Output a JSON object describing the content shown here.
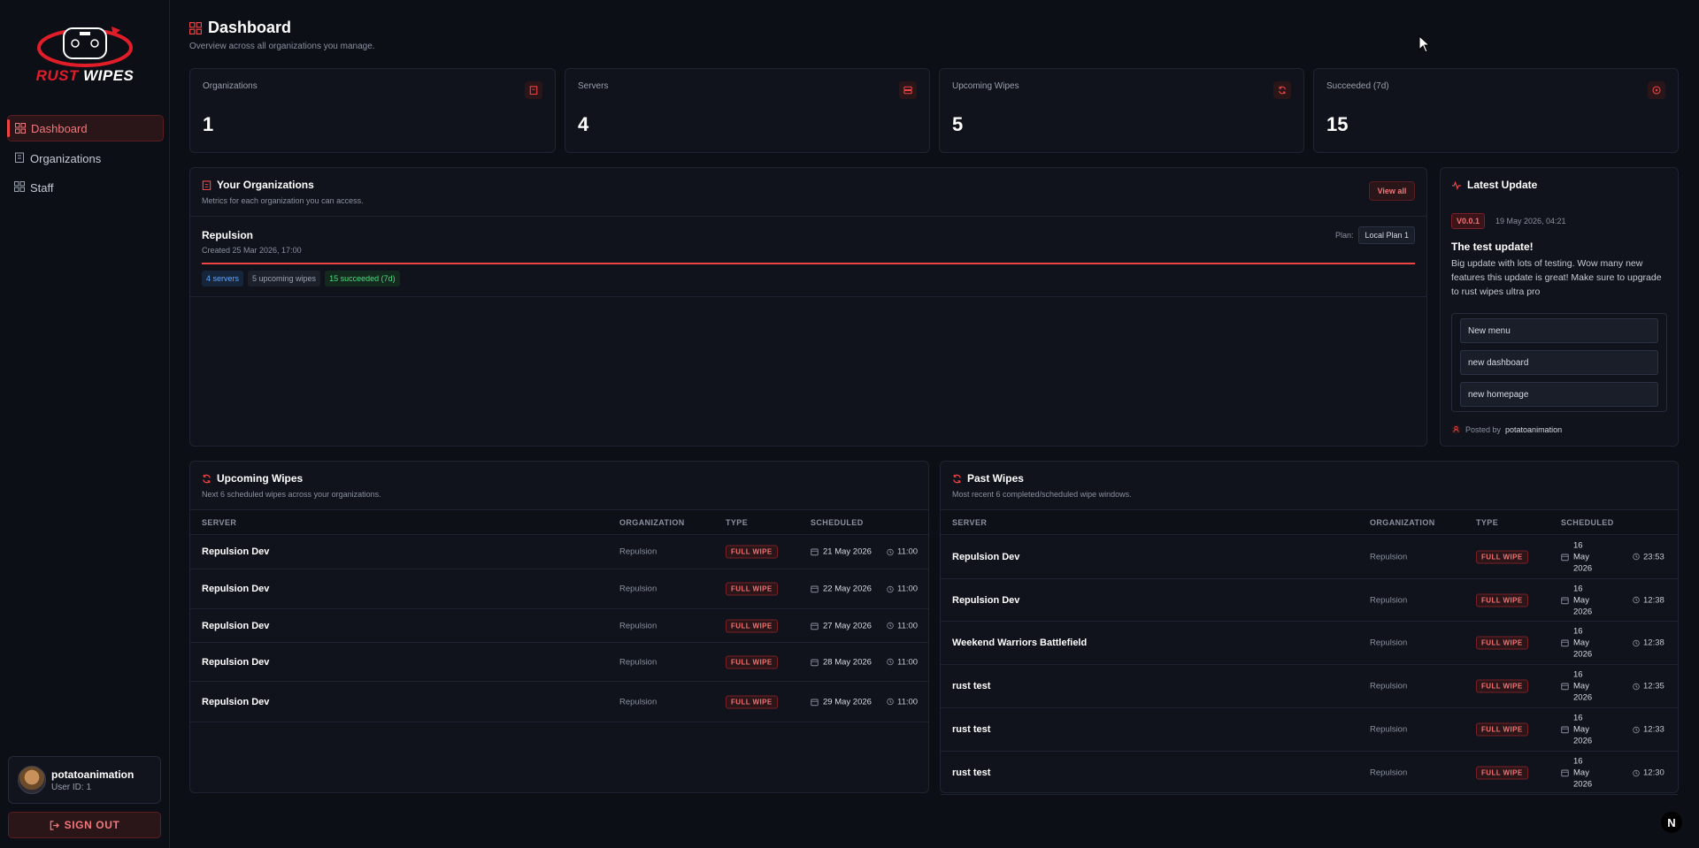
{
  "brand": {
    "name_part1": "RUST",
    "name_part2": "WIPES",
    "accent": "#ef4444"
  },
  "sidebar": {
    "items": [
      {
        "label": "Dashboard",
        "icon": "dashboard-icon",
        "active": true
      },
      {
        "label": "Organizations",
        "icon": "building-icon",
        "active": false
      },
      {
        "label": "Staff",
        "icon": "staff-icon",
        "active": false
      }
    ],
    "user": {
      "name": "potatoanimation",
      "id_text": "User ID: 1"
    },
    "signout_label": "SIGN OUT"
  },
  "header": {
    "title": "Dashboard",
    "subtitle": "Overview across all organizations you manage."
  },
  "stats": [
    {
      "label": "Organizations",
      "value": "1",
      "icon": "building-icon"
    },
    {
      "label": "Servers",
      "value": "4",
      "icon": "server-icon"
    },
    {
      "label": "Upcoming Wipes",
      "value": "5",
      "icon": "refresh-icon"
    },
    {
      "label": "Succeeded (7d)",
      "value": "15",
      "icon": "check-circle-icon"
    }
  ],
  "organizations": {
    "title": "Your Organizations",
    "subtitle": "Metrics for each organization you can access.",
    "view_all": "View all",
    "items": [
      {
        "name": "Repulsion",
        "created": "Created 25 Mar 2026, 17:00",
        "plan_label": "Plan:",
        "plan": "Local Plan 1",
        "chips": {
          "servers": "4 servers",
          "upcoming": "5 upcoming wipes",
          "succeeded": "15 succeeded (7d)"
        }
      }
    ]
  },
  "latest_update": {
    "title": "Latest Update",
    "version": "V0.0.1",
    "date": "19 May 2026, 04:21",
    "headline": "The test update!",
    "body": "Big update with lots of testing. Wow many new features this update is great! Make sure to upgrade to rust wipes ultra pro",
    "items": [
      "New menu",
      "new dashboard",
      "new homepage"
    ],
    "posted_prefix": "Posted by",
    "posted_by": "potatoanimation"
  },
  "upcoming": {
    "title": "Upcoming Wipes",
    "subtitle": "Next 6 scheduled wipes across your organizations.",
    "columns": [
      "SERVER",
      "ORGANIZATION",
      "TYPE",
      "SCHEDULED"
    ],
    "rows": [
      {
        "server": "Repulsion Dev",
        "org": "Repulsion",
        "type": "FULL WIPE",
        "date": "21 May 2026",
        "time": "11:00"
      },
      {
        "server": "Repulsion Dev",
        "org": "Repulsion",
        "type": "FULL WIPE",
        "date": "22 May 2026",
        "time": "11:00"
      },
      {
        "server": "Repulsion Dev",
        "org": "Repulsion",
        "type": "FULL WIPE",
        "date": "27 May 2026",
        "time": "11:00"
      },
      {
        "server": "Repulsion Dev",
        "org": "Repulsion",
        "type": "FULL WIPE",
        "date": "28 May 2026",
        "time": "11:00"
      },
      {
        "server": "Repulsion Dev",
        "org": "Repulsion",
        "type": "FULL WIPE",
        "date": "29 May 2026",
        "time": "11:00"
      }
    ]
  },
  "past": {
    "title": "Past Wipes",
    "subtitle": "Most recent 6 completed/scheduled wipe windows.",
    "columns": [
      "SERVER",
      "ORGANIZATION",
      "TYPE",
      "SCHEDULED"
    ],
    "rows": [
      {
        "server": "Repulsion Dev",
        "org": "Repulsion",
        "type": "FULL WIPE",
        "date": "16 May 2026",
        "time": "23:53"
      },
      {
        "server": "Repulsion Dev",
        "org": "Repulsion",
        "type": "FULL WIPE",
        "date": "16 May 2026",
        "time": "12:38"
      },
      {
        "server": "Weekend Warriors Battlefield",
        "org": "Repulsion",
        "type": "FULL WIPE",
        "date": "16 May 2026",
        "time": "12:38"
      },
      {
        "server": "rust test",
        "org": "Repulsion",
        "type": "FULL WIPE",
        "date": "16 May 2026",
        "time": "12:35"
      },
      {
        "server": "rust test",
        "org": "Repulsion",
        "type": "FULL WIPE",
        "date": "16 May 2026",
        "time": "12:33"
      },
      {
        "server": "rust test",
        "org": "Repulsion",
        "type": "FULL WIPE",
        "date": "16 May 2026",
        "time": "12:30"
      }
    ]
  },
  "dev_badge": "N"
}
